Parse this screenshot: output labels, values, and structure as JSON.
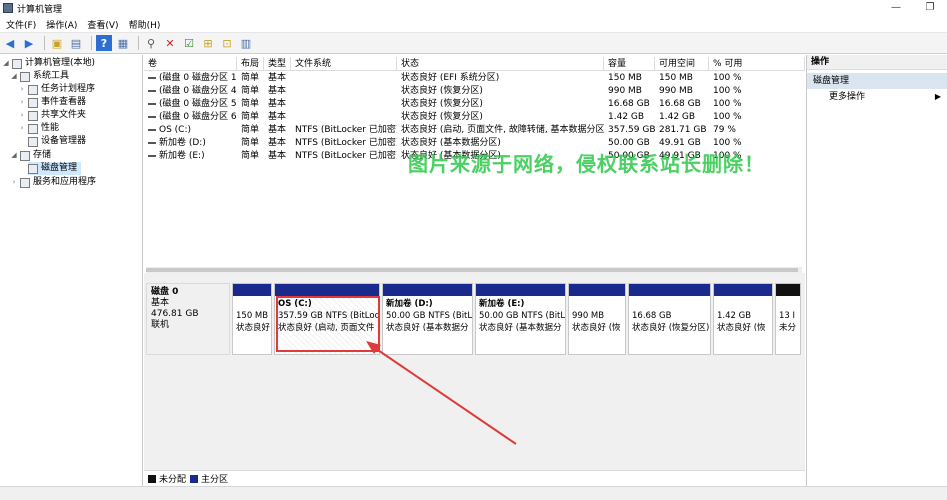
{
  "window": {
    "title": "计算机管理",
    "minimize": "—",
    "restore": "❐"
  },
  "menu": [
    "文件(F)",
    "操作(A)",
    "查看(V)",
    "帮助(H)"
  ],
  "tree": {
    "root": "计算机管理(本地)",
    "system_tools": "系统工具",
    "task_scheduler": "任务计划程序",
    "event_viewer": "事件查看器",
    "shared_folders": "共享文件夹",
    "performance": "性能",
    "device_manager": "设备管理器",
    "storage": "存储",
    "disk_management": "磁盘管理",
    "services": "服务和应用程序"
  },
  "table": {
    "headers": [
      "卷",
      "布局",
      "类型",
      "文件系统",
      "状态",
      "容量",
      "可用空间",
      "% 可用"
    ],
    "rows": [
      [
        "(磁盘 0 磁盘分区 1)",
        "简单",
        "基本",
        "",
        "状态良好 (EFI 系统分区)",
        "150 MB",
        "150 MB",
        "100 %"
      ],
      [
        "(磁盘 0 磁盘分区 4)",
        "简单",
        "基本",
        "",
        "状态良好 (恢复分区)",
        "990 MB",
        "990 MB",
        "100 %"
      ],
      [
        "(磁盘 0 磁盘分区 5)",
        "简单",
        "基本",
        "",
        "状态良好 (恢复分区)",
        "16.68 GB",
        "16.68 GB",
        "100 %"
      ],
      [
        "(磁盘 0 磁盘分区 6)",
        "简单",
        "基本",
        "",
        "状态良好 (恢复分区)",
        "1.42 GB",
        "1.42 GB",
        "100 %"
      ],
      [
        "OS (C:)",
        "简单",
        "基本",
        "NTFS (BitLocker 已加密)",
        "状态良好 (启动, 页面文件, 故障转储, 基本数据分区)",
        "357.59 GB",
        "281.71 GB",
        "79 %"
      ],
      [
        "新加卷 (D:)",
        "简单",
        "基本",
        "NTFS (BitLocker 已加密)",
        "状态良好 (基本数据分区)",
        "50.00 GB",
        "49.91 GB",
        "100 %"
      ],
      [
        "新加卷 (E:)",
        "简单",
        "基本",
        "NTFS (BitLocker 已加密)",
        "状态良好 (基本数据分区)",
        "50.00 GB",
        "49.91 GB",
        "100 %"
      ]
    ]
  },
  "disk": {
    "name": "磁盘 0",
    "type": "基本",
    "size": "476.81 GB",
    "status": "联机",
    "partitions": [
      {
        "line1": "",
        "line2": "150 MB",
        "line3": "状态良好"
      },
      {
        "line1": "OS  (C:)",
        "line2": "357.59 GB NTFS (BitLocke",
        "line3": "状态良好 (启动, 页面文件"
      },
      {
        "line1": "新加卷  (D:)",
        "line2": "50.00 GB NTFS (BitL",
        "line3": "状态良好 (基本数据分"
      },
      {
        "line1": "新加卷  (E:)",
        "line2": "50.00 GB NTFS (BitL",
        "line3": "状态良好 (基本数据分"
      },
      {
        "line1": "",
        "line2": "990 MB",
        "line3": "状态良好 (恢"
      },
      {
        "line1": "",
        "line2": "16.68 GB",
        "line3": "状态良好 (恢复分区)"
      },
      {
        "line1": "",
        "line2": "1.42 GB",
        "line3": "状态良好 (恢"
      },
      {
        "line1": "",
        "line2": "13 I",
        "line3": "未分"
      }
    ]
  },
  "legend": {
    "unallocated": "未分配",
    "primary": "主分区"
  },
  "actions": {
    "header": "操作",
    "section": "磁盘管理",
    "more": "更多操作"
  },
  "watermark": "图片来源于网络，侵权联系站长删除！",
  "colors": {
    "partition_bar": "#1a2a8c",
    "unallocated": "#111111",
    "highlight": "#e03a3a",
    "watermark": "#2cc84a"
  }
}
